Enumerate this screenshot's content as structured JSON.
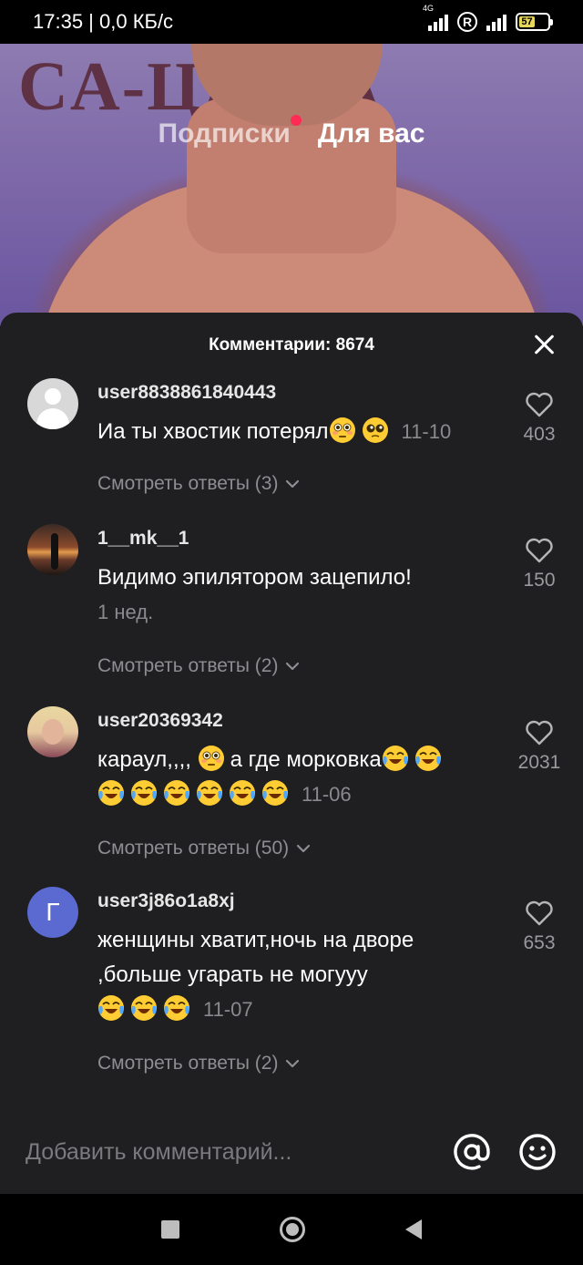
{
  "status_bar": {
    "time_speed": "17:35 | 0,0 КБ/с",
    "network": "4G",
    "battery": "57"
  },
  "feed_tabs": {
    "subscriptions": "Подписки",
    "for_you": "Для вас"
  },
  "video": {
    "banner_text": "CA-ЦА-CA"
  },
  "comments_sheet": {
    "title": "Комментарии: 8674",
    "comments": [
      {
        "username": "user8838861840443",
        "text": "Иа ты хвостик потерял",
        "emojis": [
          "flushed-face",
          "pleading-face"
        ],
        "date": "11-10",
        "likes": "403",
        "replies_label": "Смотреть ответы (3)"
      },
      {
        "username": "1__mk__1",
        "text": "Видимо эпилятором зацепило!",
        "date": "1 нед.",
        "likes": "150",
        "replies_label": "Смотреть ответы (2)"
      },
      {
        "username": "user20369342",
        "text_before": "караул,,,, ",
        "text_mid": "а где морковка",
        "emojis": [
          "flushed-face",
          "joy-face x8"
        ],
        "date": "11-06",
        "likes": "2031",
        "replies_label": "Смотреть ответы (50)"
      },
      {
        "username": "user3j86o1a8xj",
        "avatar_letter": "Г",
        "text": "женщины хватит,ночь на дворе ,больше угарать не могууу",
        "emojis": [
          "joy-face x3"
        ],
        "date": "11-07",
        "likes": "653",
        "replies_label": "Смотреть ответы (2)"
      }
    ]
  },
  "input": {
    "placeholder": "Добавить комментарий..."
  },
  "colors": {
    "sheet_bg": "#1f1f21",
    "accent_dot": "#fe2c55",
    "secondary_text": "#8e8e92",
    "avatar_letter_bg": "#5b6ad0"
  }
}
